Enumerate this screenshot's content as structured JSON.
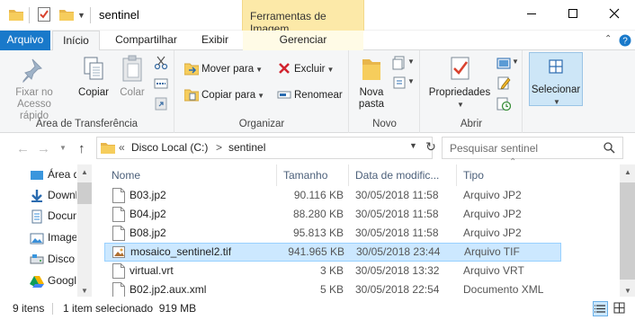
{
  "window": {
    "title": "sentinel",
    "context_tab_header": "Ferramentas de Imagem"
  },
  "tabs": {
    "file": "Arquivo",
    "home": "Início",
    "share": "Compartilhar",
    "view": "Exibir",
    "manage": "Gerenciar"
  },
  "ribbon": {
    "clipboard": {
      "label": "Área de Transferência",
      "pin_line1": "Fixar no",
      "pin_line2": "Acesso rápido",
      "copy": "Copiar",
      "paste": "Colar"
    },
    "organize": {
      "label": "Organizar",
      "move_to": "Mover para",
      "copy_to": "Copiar para",
      "delete": "Excluir",
      "rename": "Renomear"
    },
    "new": {
      "label": "Novo",
      "new_folder_line1": "Nova",
      "new_folder_line2": "pasta"
    },
    "open": {
      "label": "Abrir",
      "properties": "Propriedades"
    },
    "select": {
      "label": "Selecionar"
    }
  },
  "address": {
    "prefix": "«",
    "crumbs": [
      "Disco Local (C:)",
      "sentinel"
    ],
    "separator": ">"
  },
  "search": {
    "placeholder": "Pesquisar sentinel"
  },
  "nav_pane": {
    "items": [
      {
        "label": "Área de Trabalho",
        "icon": "desktop-icon"
      },
      {
        "label": "Downloads",
        "icon": "download-icon"
      },
      {
        "label": "Documentos",
        "icon": "documents-icon"
      },
      {
        "label": "Imagens",
        "icon": "pictures-icon"
      },
      {
        "label": "Disco Local (C:)",
        "icon": "drive-icon"
      },
      {
        "label": "Google Drive",
        "icon": "google-drive-icon"
      }
    ]
  },
  "file_list": {
    "columns": {
      "name": "Nome",
      "size": "Tamanho",
      "date": "Data de modific...",
      "type": "Tipo"
    },
    "rows": [
      {
        "name": "B03.jp2",
        "size": "90.116 KB",
        "date": "30/05/2018 11:58",
        "type": "Arquivo JP2",
        "icon": "file-icon",
        "selected": false
      },
      {
        "name": "B04.jp2",
        "size": "88.280 KB",
        "date": "30/05/2018 11:58",
        "type": "Arquivo JP2",
        "icon": "file-icon",
        "selected": false
      },
      {
        "name": "B08.jp2",
        "size": "95.813 KB",
        "date": "30/05/2018 11:58",
        "type": "Arquivo JP2",
        "icon": "file-icon",
        "selected": false
      },
      {
        "name": "mosaico_sentinel2.tif",
        "size": "941.965 KB",
        "date": "30/05/2018 23:44",
        "type": "Arquivo TIF",
        "icon": "image-file-icon",
        "selected": true
      },
      {
        "name": "virtual.vrt",
        "size": "3 KB",
        "date": "30/05/2018 13:32",
        "type": "Arquivo VRT",
        "icon": "file-icon",
        "selected": false
      },
      {
        "name": "B02.jp2.aux.xml",
        "size": "5 KB",
        "date": "30/05/2018 22:54",
        "type": "Documento XML",
        "icon": "file-icon",
        "selected": false
      }
    ]
  },
  "status": {
    "item_count": "9 itens",
    "selection": "1 item selecionado  919 MB"
  },
  "colors": {
    "accent": "#1979ca",
    "context_tab": "#fce9a8",
    "selection": "#cce8ff",
    "selection_border": "#99d1ff",
    "close_red": "#e81123"
  }
}
